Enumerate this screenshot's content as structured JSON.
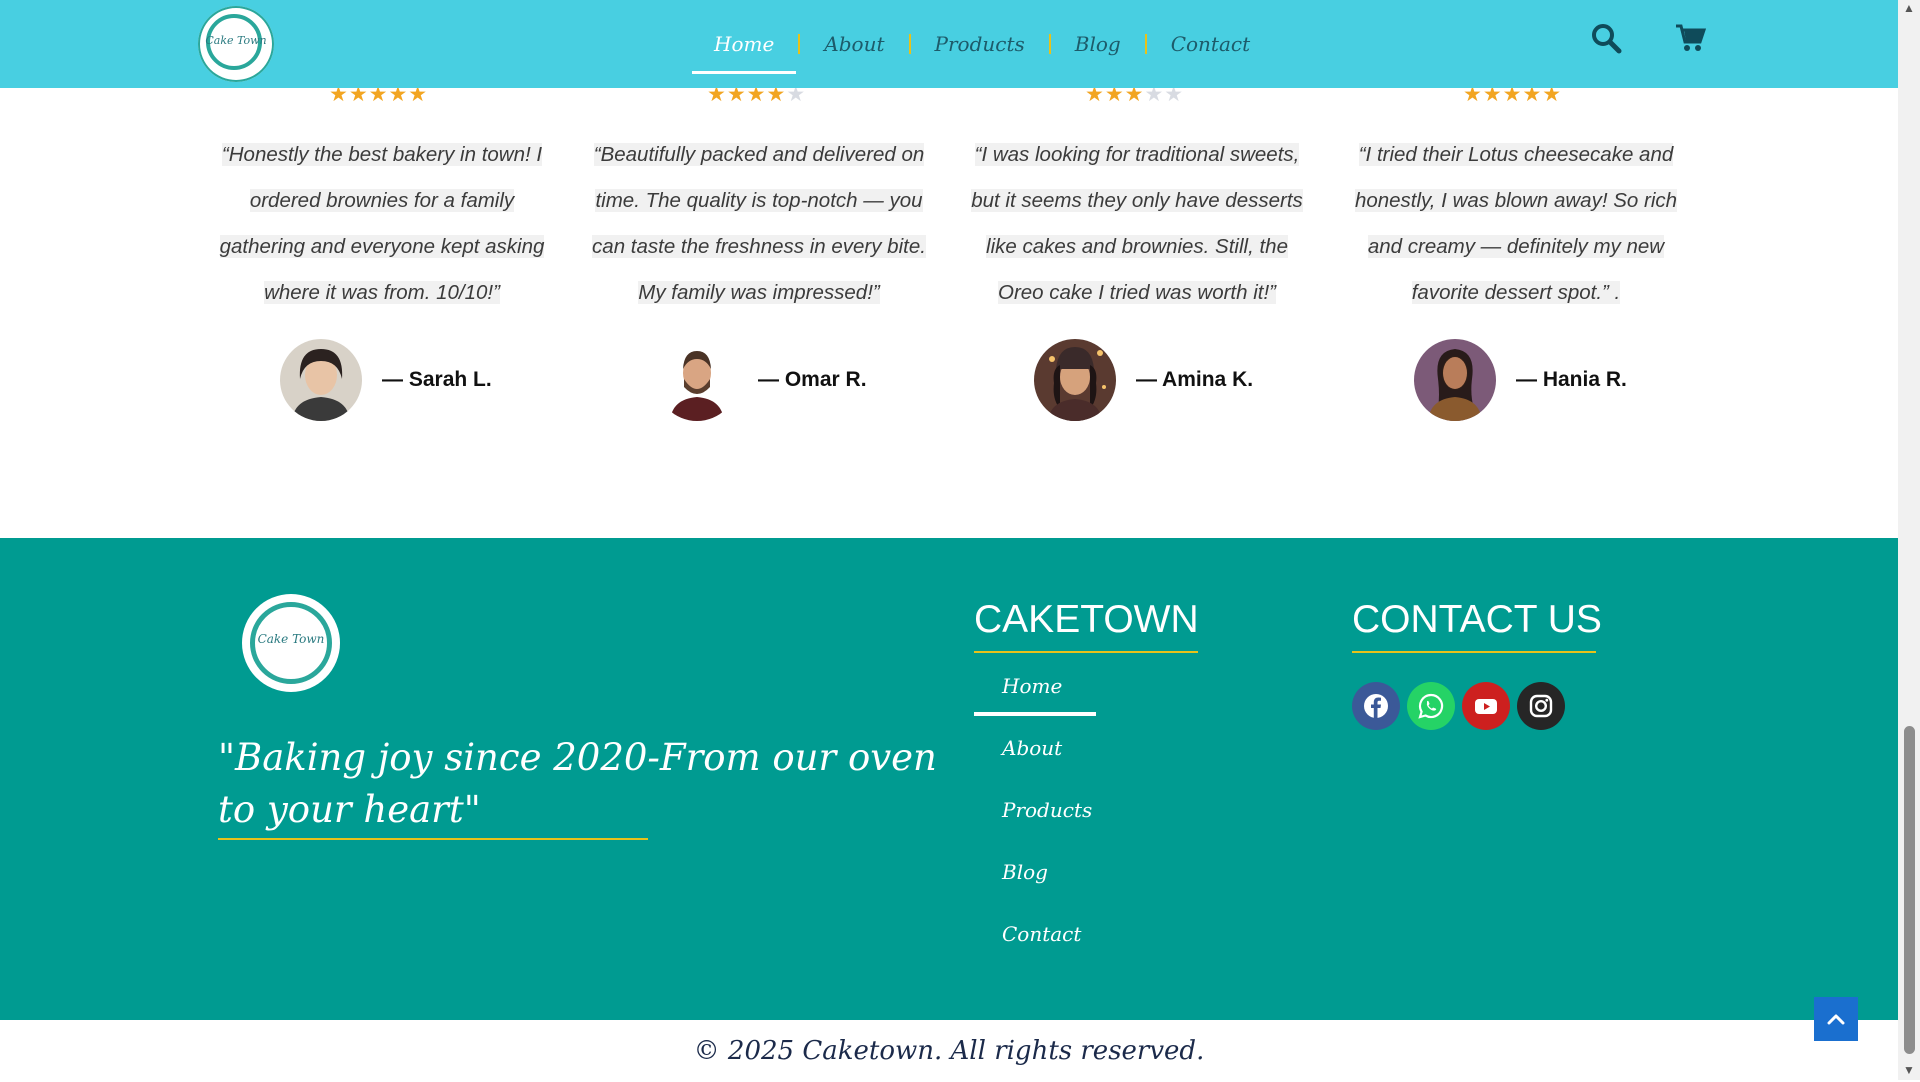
{
  "header": {
    "logo_text": "Cake Town",
    "nav": [
      {
        "label": "Home",
        "active": true
      },
      {
        "label": "About",
        "active": false
      },
      {
        "label": "Products",
        "active": false
      },
      {
        "label": "Blog",
        "active": false
      },
      {
        "label": "Contact",
        "active": false
      }
    ],
    "icons": [
      "search-icon",
      "cart-icon"
    ]
  },
  "testimonials": [
    {
      "rating": 5,
      "quote": "“Honestly the best bakery in town! I ordered brownies for a family gathering and everyone kept asking where it was from. 10/10!”",
      "name": "— Sarah L."
    },
    {
      "rating": 4.5,
      "quote": "“Beautifully packed and delivered on time. The quality is top-notch — you can taste the freshness in every bite. My family was impressed!”",
      "name": "— Omar R."
    },
    {
      "rating": 3,
      "quote": "“I was looking for traditional sweets, but it seems they only have desserts like cakes and brownies. Still, the Oreo cake I tried was worth it!”",
      "name": "— Amina K."
    },
    {
      "rating": 5,
      "quote": "“I tried their Lotus cheesecake and honestly, I was blown away! So rich and creamy — definitely my new favorite dessert spot.” .",
      "name": "— Hania R."
    }
  ],
  "footer": {
    "logo_text": "Cake Town",
    "tagline": "\"Baking joy since 2020-From our oven to your heart\"",
    "caketown_heading": "CAKETOWN",
    "links": [
      "Home",
      "About",
      "Products",
      "Blog",
      "Contact"
    ],
    "contact_heading": "CONTACT US",
    "social": [
      {
        "name": "facebook-icon",
        "color": "#3b5998"
      },
      {
        "name": "whatsapp-icon",
        "color": "#25d366"
      },
      {
        "name": "youtube-icon",
        "color": "#cd201f"
      },
      {
        "name": "instagram-icon",
        "color": "#262626"
      }
    ]
  },
  "copyright": "© 2025 Caketown. All rights reserved.",
  "colors": {
    "header_bg": "#48cfe1",
    "footer_bg": "#009b91",
    "accent_gold": "#e7c21a",
    "star": "#f2a521",
    "to_top": "#1a6fcf"
  }
}
